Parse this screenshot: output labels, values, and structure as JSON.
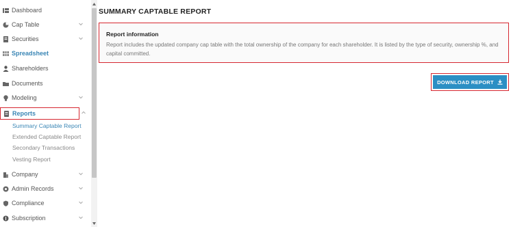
{
  "sidebar": {
    "items": [
      {
        "label": "Dashboard",
        "icon": "dashboard-icon",
        "chevron": false
      },
      {
        "label": "Cap Table",
        "icon": "pie-chart-icon",
        "chevron": true
      },
      {
        "label": "Securities",
        "icon": "document-icon",
        "chevron": true
      },
      {
        "label": "Spreadsheet",
        "icon": "grid-icon",
        "chevron": false
      },
      {
        "label": "Shareholders",
        "icon": "person-icon",
        "chevron": false
      },
      {
        "label": "Documents",
        "icon": "folder-icon",
        "chevron": false
      },
      {
        "label": "Modeling",
        "icon": "lightbulb-icon",
        "chevron": true
      },
      {
        "label": "Reports",
        "icon": "report-icon",
        "chevron": true
      }
    ],
    "sub_items": [
      "Summary Captable Report",
      "Extended Captable Report",
      "Secondary Transactions",
      "Vesting Report"
    ],
    "lower_items": [
      {
        "label": "Company",
        "icon": "building-icon",
        "chevron": true
      },
      {
        "label": "Admin Records",
        "icon": "record-icon",
        "chevron": true
      },
      {
        "label": "Compliance",
        "icon": "shield-icon",
        "chevron": true
      },
      {
        "label": "Subscription",
        "icon": "subscription-icon",
        "chevron": true
      }
    ]
  },
  "main": {
    "title": "SUMMARY CAPTABLE REPORT",
    "info": {
      "heading": "Report information",
      "text": "Report includes the updated company cap table with the total ownership of the company for each shareholder. It is listed by the type of security, ownership %, and capital committed."
    },
    "download_label": "DOWNLOAD REPORT"
  },
  "colors": {
    "accent": "#2b8fc4",
    "active_text": "#3a86b5",
    "highlight_border": "#d6262f"
  }
}
